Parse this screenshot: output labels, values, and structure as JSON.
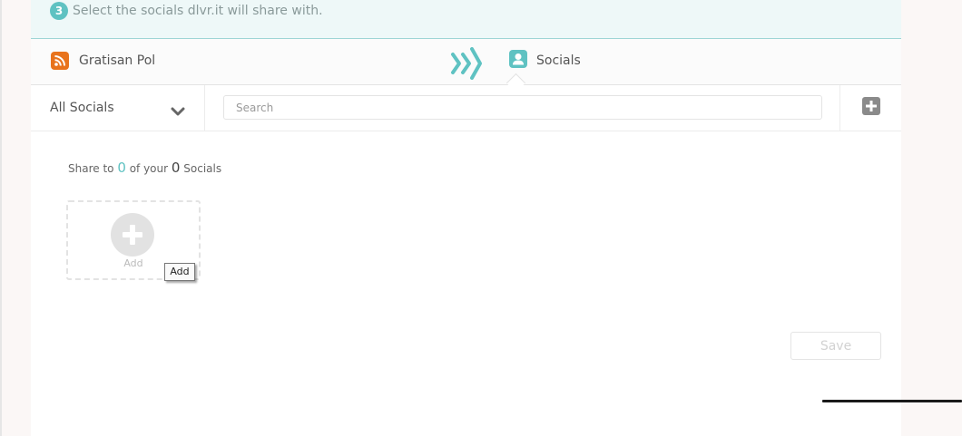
{
  "step": {
    "number": "3",
    "text": "Select the socials dlvr.it will share with."
  },
  "flow": {
    "source_name": "Gratisan Pol",
    "target_label": "Socials",
    "source_icon": "rss-icon",
    "target_icon": "user-icon",
    "arrow_icon": "double-chevron-right-icon"
  },
  "filter": {
    "selected": "All Socials",
    "search_placeholder": "Search"
  },
  "share": {
    "prefix": "Share to",
    "selected_count": "0",
    "middle": "of your",
    "total_count": "0",
    "suffix": "Socials"
  },
  "add_card": {
    "label": "Add",
    "tooltip": "Add"
  },
  "buttons": {
    "save": "Save"
  },
  "colors": {
    "accent": "#5fc2c2",
    "rss": "#e8731c",
    "banner_bg": "#eef8f8",
    "page_bg": "#fbf7f6"
  }
}
